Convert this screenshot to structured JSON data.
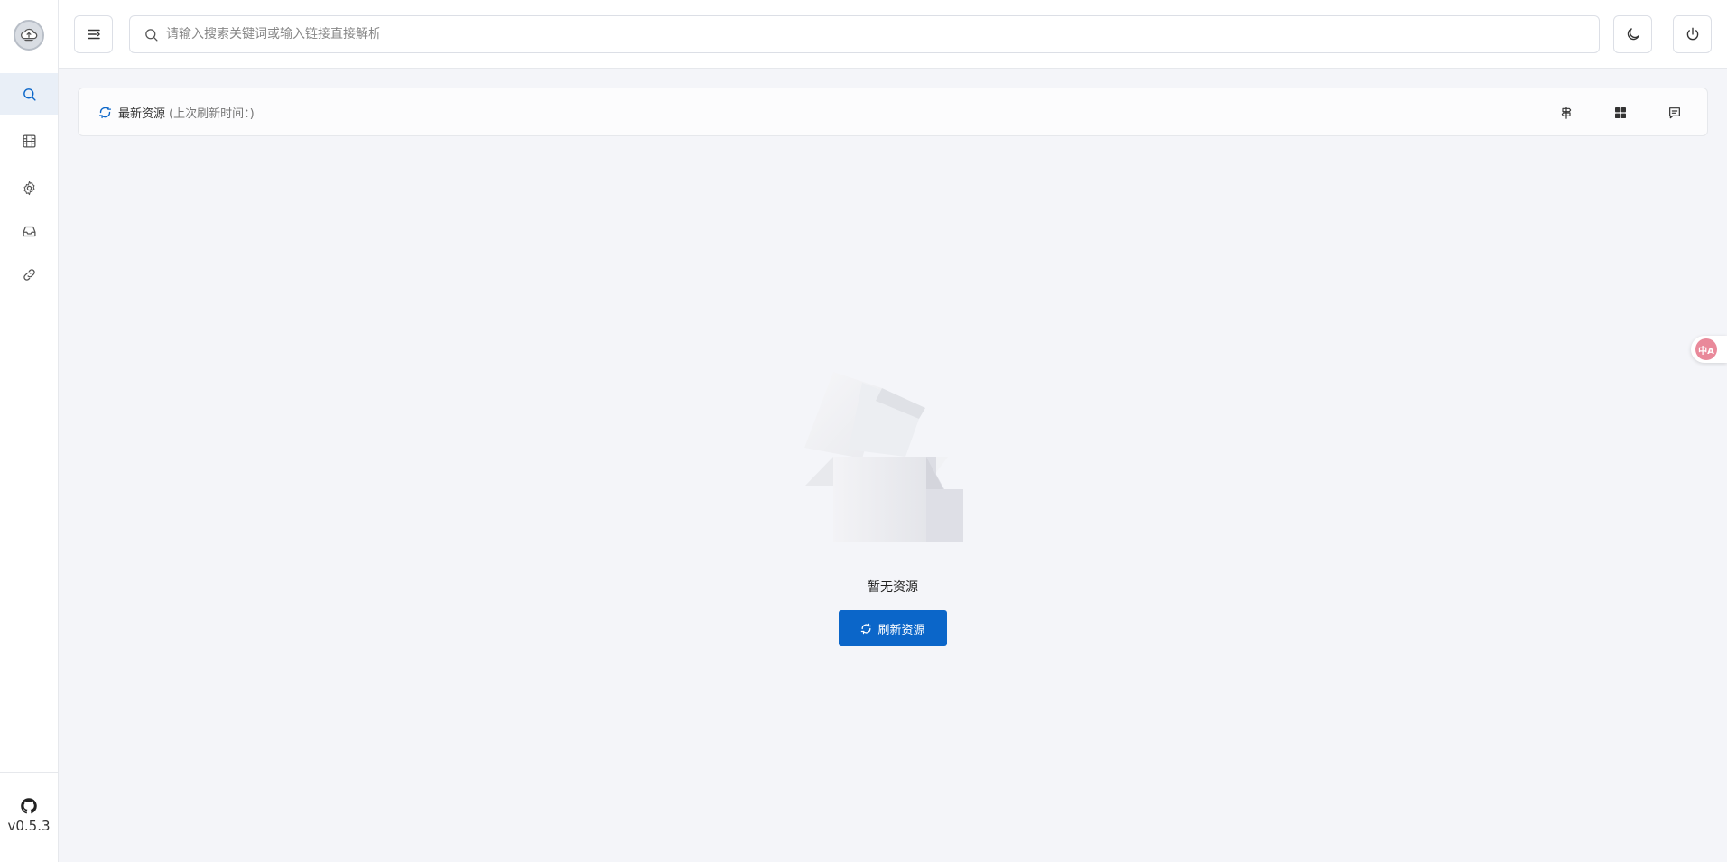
{
  "sidebar": {
    "items": [
      {
        "icon": "search-icon",
        "active": true
      },
      {
        "icon": "film-icon",
        "active": false
      },
      {
        "icon": "gear-icon",
        "active": false
      },
      {
        "icon": "inbox-icon",
        "active": false
      },
      {
        "icon": "link-icon",
        "active": false
      }
    ],
    "version": "v0.5.3"
  },
  "header": {
    "search_placeholder": "请输入搜索关键词或输入链接直接解析"
  },
  "resources": {
    "title": "最新资源",
    "refresh_time": "(上次刷新时间：)"
  },
  "empty": {
    "text": "暂无资源",
    "button_label": "刷新资源"
  },
  "translate": {
    "label": "中A"
  },
  "colors": {
    "accent": "#0b66c9",
    "active_nav_bg": "#e9eff7",
    "background": "#f4f5f9"
  }
}
